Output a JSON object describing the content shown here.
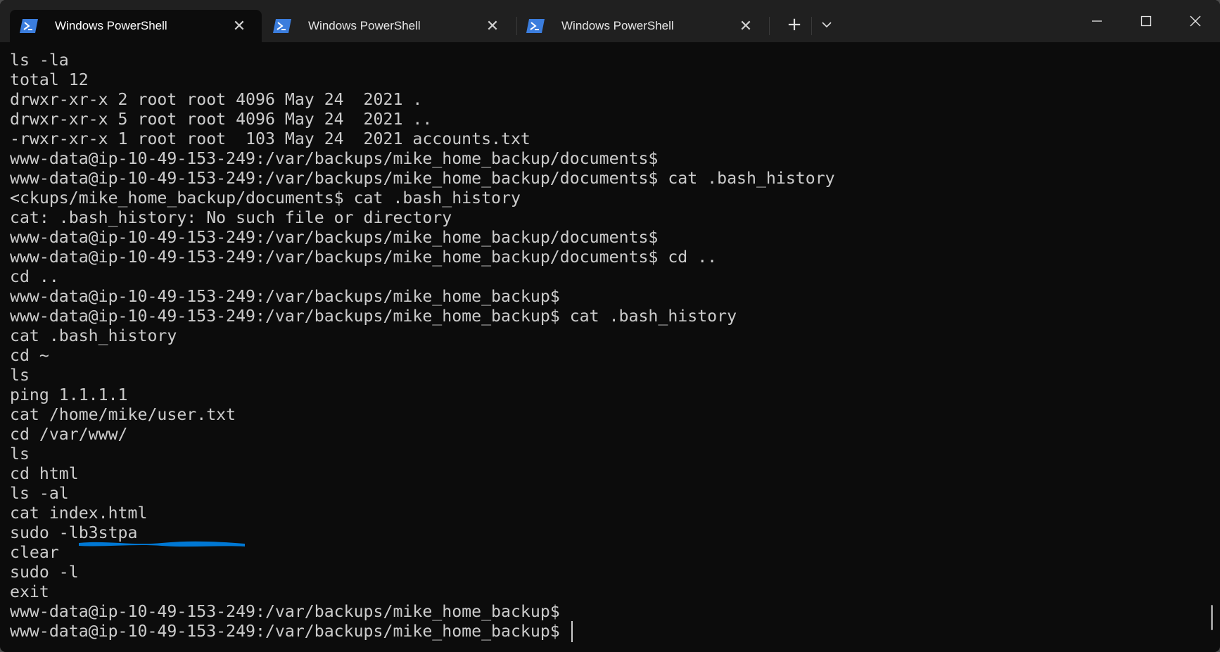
{
  "window": {
    "tabs": [
      {
        "title": "Windows PowerShell",
        "active": true
      },
      {
        "title": "Windows PowerShell",
        "active": false
      },
      {
        "title": "Windows PowerShell",
        "active": false
      }
    ],
    "new_tab_glyph": "+",
    "dropdown_icon": "chevron-down-icon",
    "tab_icon": "powershell-icon",
    "close_glyph": "✕"
  },
  "terminal": {
    "lines": [
      "ls -la",
      "total 12",
      "drwxr-xr-x 2 root root 4096 May 24  2021 .",
      "drwxr-xr-x 5 root root 4096 May 24  2021 ..",
      "-rwxr-xr-x 1 root root  103 May 24  2021 accounts.txt",
      "www-data@ip-10-49-153-249:/var/backups/mike_home_backup/documents$",
      "www-data@ip-10-49-153-249:/var/backups/mike_home_backup/documents$ cat .bash_history",
      "<ckups/mike_home_backup/documents$ cat .bash_history",
      "cat: .bash_history: No such file or directory",
      "www-data@ip-10-49-153-249:/var/backups/mike_home_backup/documents$",
      "www-data@ip-10-49-153-249:/var/backups/mike_home_backup/documents$ cd ..",
      "cd ..",
      "www-data@ip-10-49-153-249:/var/backups/mike_home_backup$",
      "www-data@ip-10-49-153-249:/var/backups/mike_home_backup$ cat .bash_history",
      "cat .bash_history",
      "cd ~",
      "ls",
      "ping 1.1.1.1",
      "cat /home/mike/user.txt",
      "cd /var/www/",
      "ls",
      "cd html",
      "ls -al",
      "cat index.html",
      "sudo -lb3stpa",
      "clear",
      "sudo -l",
      "exit",
      "www-data@ip-10-49-153-249:/var/backups/mike_home_backup$",
      "www-data@ip-10-49-153-249:/var/backups/mike_home_backup$ "
    ]
  },
  "colors": {
    "background": "#0c0c0c",
    "titlebar": "#202020",
    "text": "#cccccc",
    "redaction": "#0078d4",
    "powershell_icon": "#3b7ddd"
  }
}
